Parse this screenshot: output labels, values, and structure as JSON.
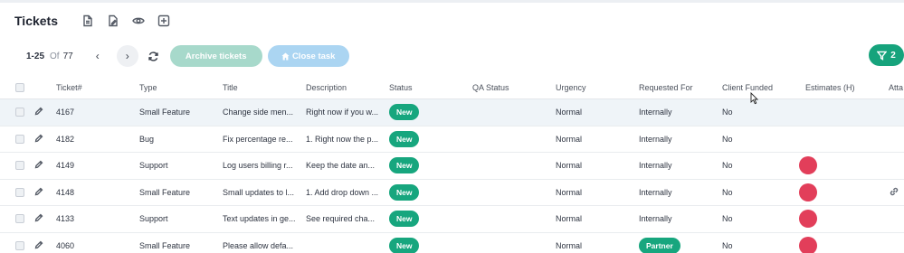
{
  "header": {
    "title": "Tickets",
    "icons": [
      "document-icon",
      "edit-document-icon",
      "eye-icon",
      "add-box-icon"
    ]
  },
  "toolbar": {
    "range": "1-25",
    "of_label": "Of",
    "total": "77",
    "prev_label": "‹",
    "next_label": "›",
    "archive_label": "Archive tickets",
    "close_label": "Close task",
    "filter_count": "2"
  },
  "table": {
    "columns": [
      "",
      "",
      "Ticket#",
      "Type",
      "Title",
      "Description",
      "Status",
      "QA Status",
      "Urgency",
      "Requested For",
      "Client Funded",
      "Estimates (H)",
      "Atta"
    ],
    "rows": [
      {
        "ticket": "4167",
        "type": "Small Feature",
        "title": "Change side men...",
        "description": "Right now if you w...",
        "status": "New",
        "qa_status": "",
        "urgency": "Normal",
        "requested_for": "Internally",
        "client_funded": "No",
        "estimate_marker": false,
        "attachment": false,
        "highlighted": true
      },
      {
        "ticket": "4182",
        "type": "Bug",
        "title": "Fix percentage re...",
        "description": "1. Right now the p...",
        "status": "New",
        "qa_status": "",
        "urgency": "Normal",
        "requested_for": "Internally",
        "client_funded": "No",
        "estimate_marker": false,
        "attachment": false,
        "highlighted": false
      },
      {
        "ticket": "4149",
        "type": "Support",
        "title": "Log users billing r...",
        "description": "Keep the date an...",
        "status": "New",
        "qa_status": "",
        "urgency": "Normal",
        "requested_for": "Internally",
        "client_funded": "No",
        "estimate_marker": true,
        "attachment": false,
        "highlighted": false
      },
      {
        "ticket": "4148",
        "type": "Small Feature",
        "title": "Small updates to l...",
        "description": "1. Add drop down ...",
        "status": "New",
        "qa_status": "",
        "urgency": "Normal",
        "requested_for": "Internally",
        "client_funded": "No",
        "estimate_marker": true,
        "attachment": true,
        "highlighted": false
      },
      {
        "ticket": "4133",
        "type": "Support",
        "title": "Text updates in ge...",
        "description": "See required cha...",
        "status": "New",
        "qa_status": "",
        "urgency": "Normal",
        "requested_for": "Internally",
        "client_funded": "No",
        "estimate_marker": true,
        "attachment": false,
        "highlighted": false
      },
      {
        "ticket": "4060",
        "type": "Small Feature",
        "title": "Please allow defa...",
        "description": "",
        "status": "New",
        "qa_status": "",
        "urgency": "Normal",
        "requested_for": "Partner",
        "client_funded": "No",
        "estimate_marker": true,
        "attachment": false,
        "highlighted": false
      }
    ]
  },
  "colors": {
    "accent_green": "#17a67e",
    "archive_disabled": "#a7d9cb",
    "close_disabled": "#abd5f2",
    "estimate_red": "#e23e5a",
    "row_highlight": "#eff4f8"
  }
}
